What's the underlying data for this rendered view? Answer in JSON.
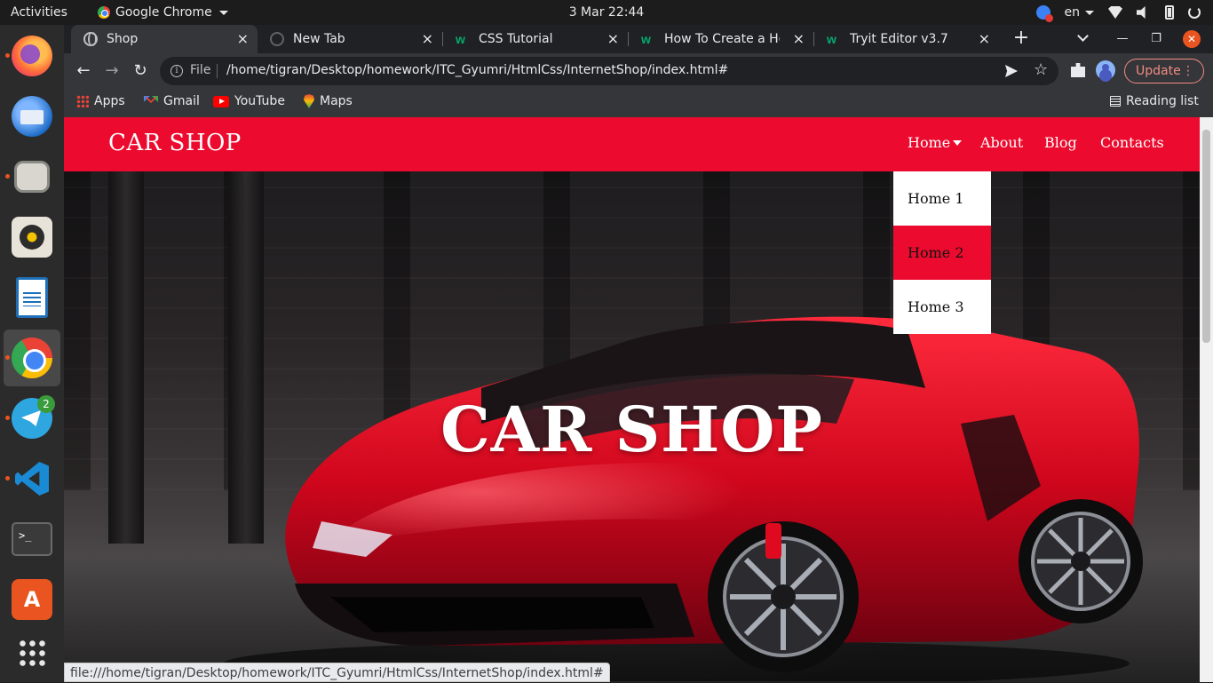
{
  "system": {
    "activities": "Activities",
    "app_menu": "Google Chrome",
    "clock": "3 Mar  22:44",
    "keyboard_layout": "en",
    "telegram_badge": "2"
  },
  "browser": {
    "tabs": [
      {
        "label": "Shop",
        "favicon": "globe-icon",
        "active": true
      },
      {
        "label": "New Tab",
        "favicon": "newtab-icon",
        "active": false
      },
      {
        "label": "CSS Tutorial",
        "favicon": "w3schools-icon",
        "active": false
      },
      {
        "label": "How To Create a Hov",
        "favicon": "w3schools-icon",
        "active": false
      },
      {
        "label": "Tryit Editor v3.7",
        "favicon": "w3schools-icon",
        "active": false
      }
    ],
    "address": {
      "scheme": "File",
      "url": "/home/tigran/Desktop/homework/ITC_Gyumri/HtmlCss/InternetShop/index.html#"
    },
    "update_label": "Update",
    "bookmarks": [
      "Apps",
      "Gmail",
      "YouTube",
      "Maps"
    ],
    "reading_list": "Reading list",
    "status_url": "file:///home/tigran/Desktop/homework/ITC_Gyumri/HtmlCss/InternetShop/index.html#"
  },
  "site": {
    "brand": "CAR SHOP",
    "nav": [
      "Home",
      "About",
      "Blog",
      "Contacts"
    ],
    "dropdown": [
      "Home 1",
      "Home 2",
      "Home 3"
    ],
    "hovered_dropdown_item": "Home 2",
    "hero_title": "CAR SHOP",
    "accent_color": "#ec0b2e"
  }
}
